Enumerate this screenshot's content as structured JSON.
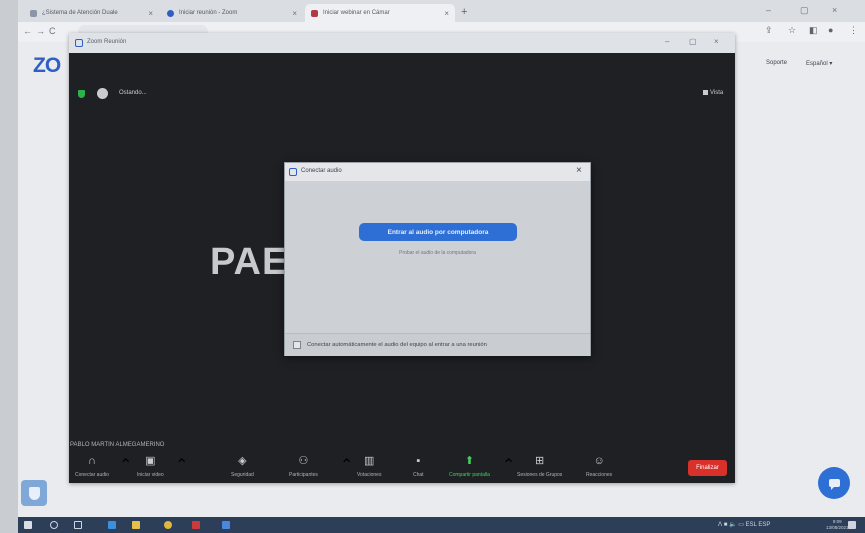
{
  "browser": {
    "tabs": [
      {
        "label": "¿Sistema de Atención Duale",
        "active": false
      },
      {
        "label": "Iniciar reunión - Zoom",
        "active": false
      },
      {
        "label": "Iniciar webinar en Cámar",
        "active": true
      }
    ],
    "new_tab_glyph": "+"
  },
  "page": {
    "logo": "ZO",
    "soporte": "Soporte",
    "language": "Español ▾"
  },
  "zoom_window": {
    "title": "Zoom Reunión",
    "connecting_text": "Ostando...",
    "view_label": "Vista",
    "participant_initials": "PAE",
    "participant_name": "PABLO MARTIN ALMEGAMERINO",
    "toolbar": {
      "audio": "Conectar audio",
      "video": "Iniciar video",
      "security": "Seguridad",
      "participants": "Participantes",
      "polls": "Votaciones",
      "chat": "Chat",
      "share": "Compartir pantalla",
      "breakout": "Sesiones de Grupos",
      "reactions": "Reacciones",
      "end": "Finalizar"
    }
  },
  "dialog": {
    "title": "Conectar audio",
    "close": "×",
    "join_button": "Entrar al audio por computadora",
    "test_link": "Probar el audio de la computadora",
    "auto_label": "Conectar automáticamente el audio del equipo al entrar a una reunión",
    "auto_checked": false
  },
  "taskbar": {
    "tray": "ᐱ ■ 🔈 ▭ ESL ESP",
    "time": "9:09",
    "date": "13/08/2021"
  },
  "colors": {
    "accent": "#2e6fd6",
    "end": "#d8302b",
    "share_green": "#3ed35a"
  }
}
